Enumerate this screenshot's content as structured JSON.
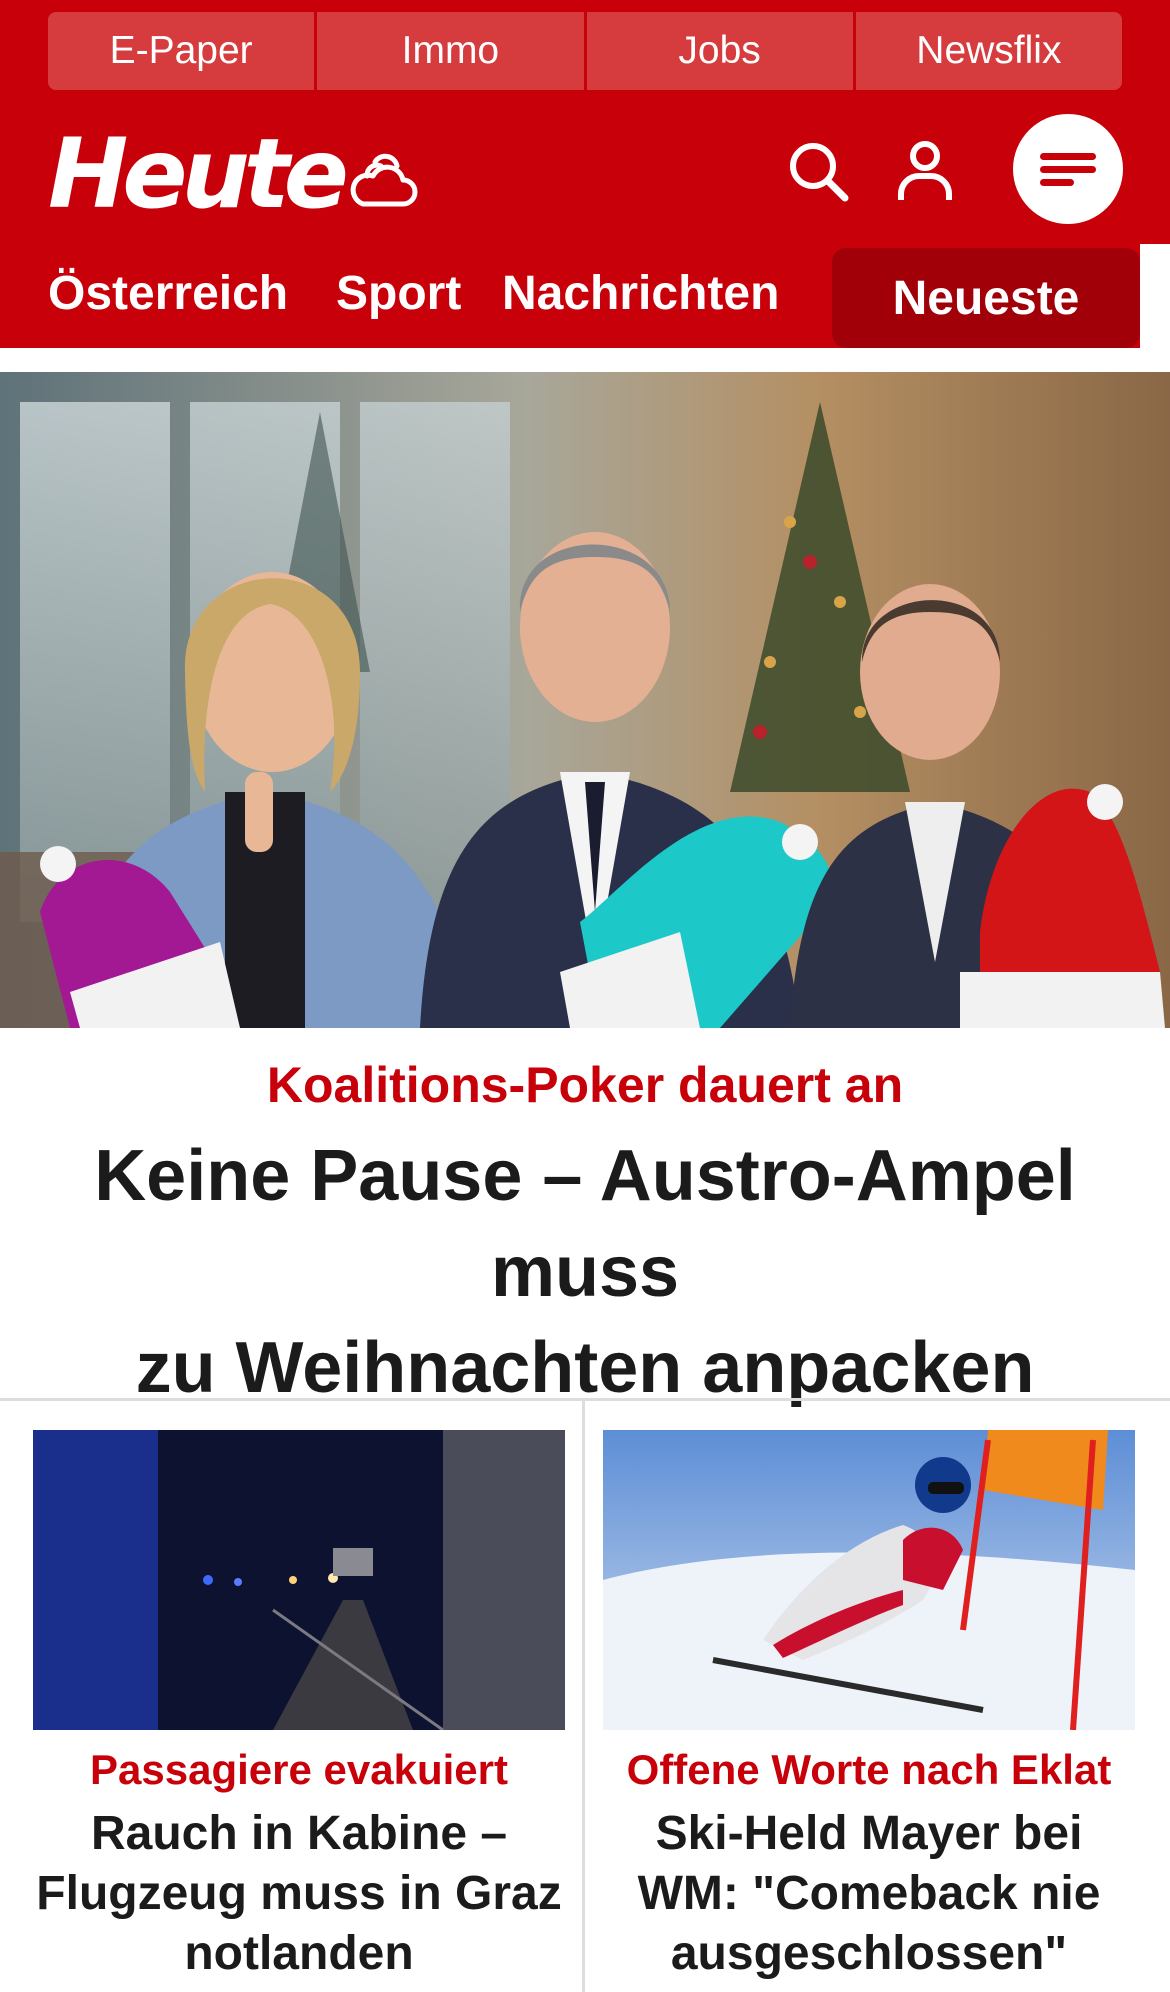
{
  "util_nav": [
    "E-Paper",
    "Immo",
    "Jobs",
    "Newsflix"
  ],
  "brand": {
    "logo": "Heute"
  },
  "icons": {
    "weather": "cloud-icon",
    "search": "search-icon",
    "account": "user-icon",
    "menu": "hamburger-icon"
  },
  "sections": [
    "Österreich",
    "Sport",
    "Nachrichten"
  ],
  "newest_label": "Neueste",
  "hero": {
    "kicker": "Koalitions-Poker dauert an",
    "title_line1": "Keine Pause – Austro-Ampel muss",
    "title_line2": "zu Weihnachten anpacken"
  },
  "cards": [
    {
      "kicker": "Passagiere evakuiert",
      "title_line1": "Rauch in Kabine –",
      "title_line2": "Flugzeug muss in Graz",
      "title_line3": "notlanden"
    },
    {
      "kicker": "Offene Worte nach Eklat",
      "title_line1": "Ski-Held Mayer bei",
      "title_line2": "WM: \"Comeback nie",
      "title_line3": "ausgeschlossen\""
    }
  ],
  "colors": {
    "brand_red": "#c8000a",
    "dark_red": "#a10008",
    "text": "#1b1b1b"
  }
}
